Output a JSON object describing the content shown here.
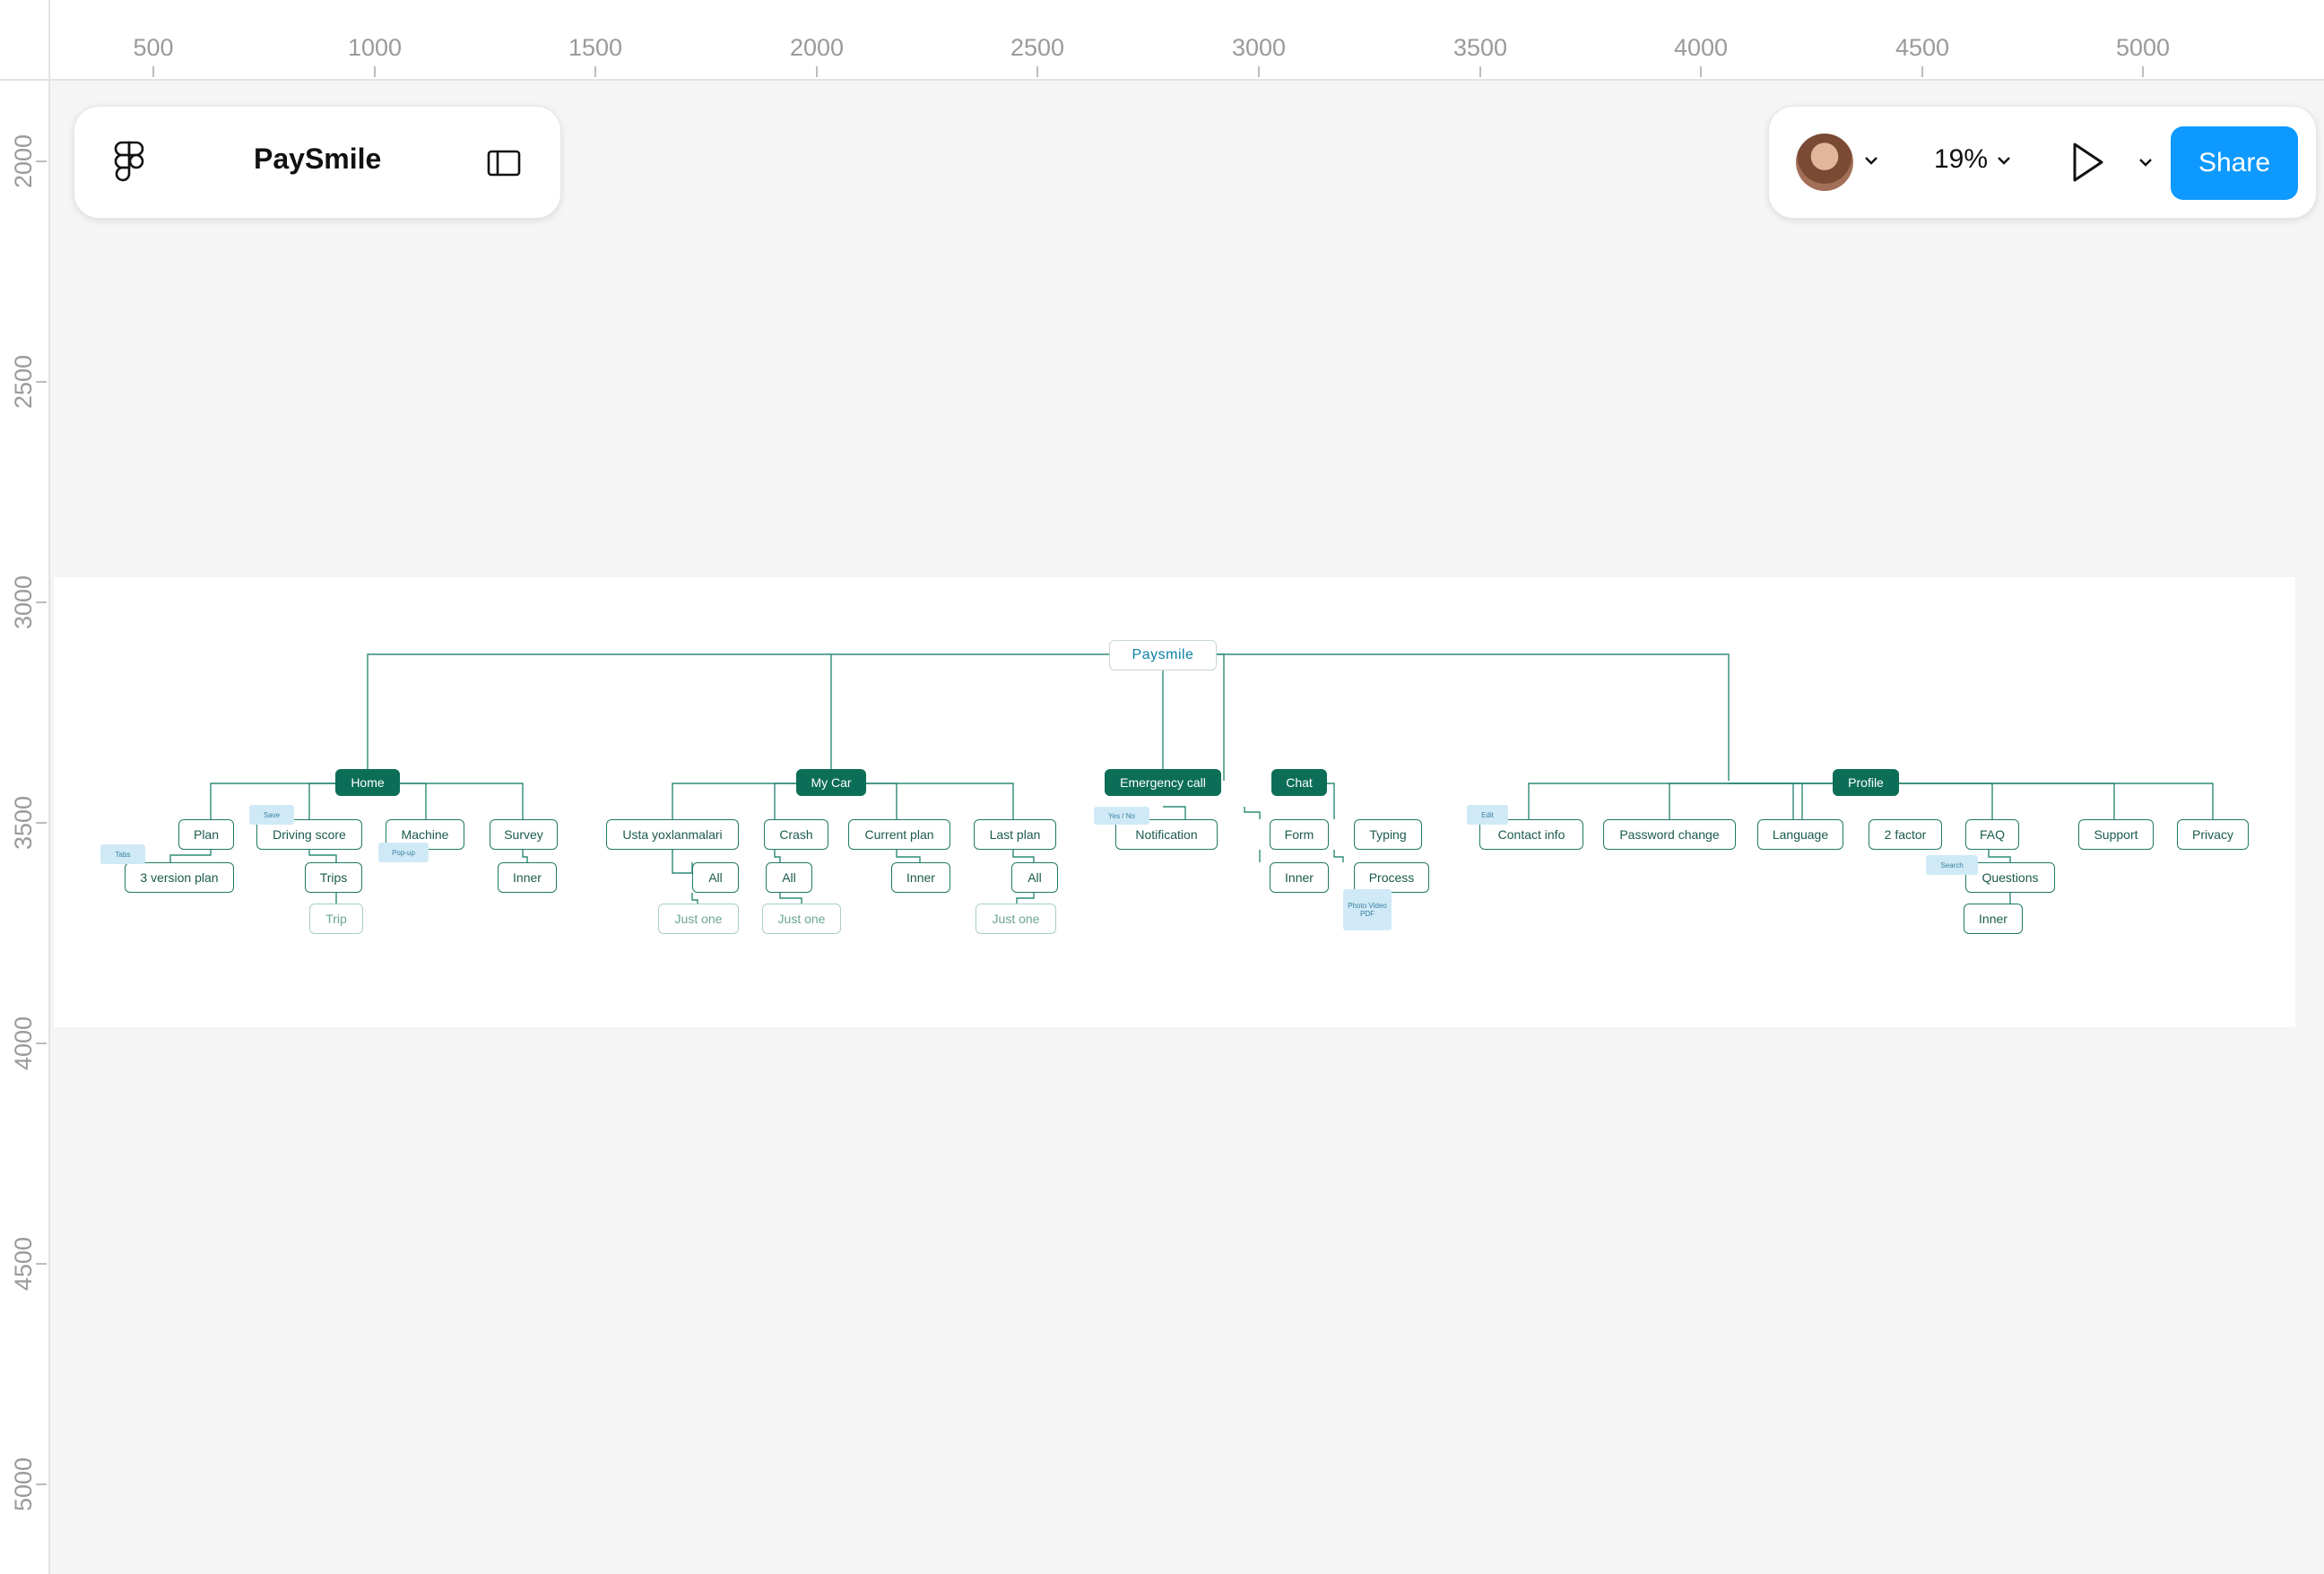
{
  "ruler": {
    "horizontal": [
      "500",
      "1000",
      "1500",
      "2000",
      "2500",
      "3000",
      "3500",
      "4000",
      "4500",
      "5000"
    ],
    "vertical": [
      "2000",
      "2500",
      "3000",
      "3500",
      "4000",
      "4500",
      "5000"
    ]
  },
  "toolbar": {
    "file_name": "PaySmile",
    "zoom_label": "19%",
    "share_label": "Share"
  },
  "icons": [
    "figma-icon",
    "sidebar-toggle-icon",
    "avatar",
    "chevron-down-icon",
    "play-icon"
  ],
  "colors": {
    "accent": "#0d99ff",
    "node_dark": "#0c6e57",
    "line": "#2e8a76",
    "note": "#cfeaf6"
  },
  "sitemap": {
    "root": "Paysmile",
    "sections": {
      "home": "Home",
      "my_car": "My Car",
      "emergency": "Emergency call",
      "chat": "Chat",
      "profile": "Profile"
    },
    "nodes": {
      "plan": "Plan",
      "version_plan": "3 version plan",
      "driving_score": "Driving score",
      "trips": "Trips",
      "trip": "Trip",
      "machine": "Machine",
      "survey": "Survey",
      "survey_inner": "Inner",
      "usta": "Usta yoxlanmalari",
      "usta_all": "All",
      "usta_just_one": "Just one",
      "crash": "Crash",
      "crash_all": "All",
      "crash_just_one": "Just one",
      "current_plan": "Current plan",
      "current_inner": "Inner",
      "last_plan": "Last plan",
      "last_all": "All",
      "last_just_one": "Just one",
      "notification": "Notification",
      "form": "Form",
      "form_inner": "Inner",
      "typing": "Typing",
      "process": "Process",
      "contact_info": "Contact info",
      "password_change": "Password change",
      "language": "Language",
      "two_factor": "2 factor",
      "faq": "FAQ",
      "questions": "Questions",
      "questions_inner": "Inner",
      "support": "Support",
      "privacy": "Privacy"
    },
    "notes": {
      "tabs": "Tabs",
      "save": "Save",
      "popup": "Pop-up",
      "yes_no": "Yes / No",
      "media": "Photo Video PDF",
      "edit": "Edit",
      "search": "Search"
    }
  }
}
